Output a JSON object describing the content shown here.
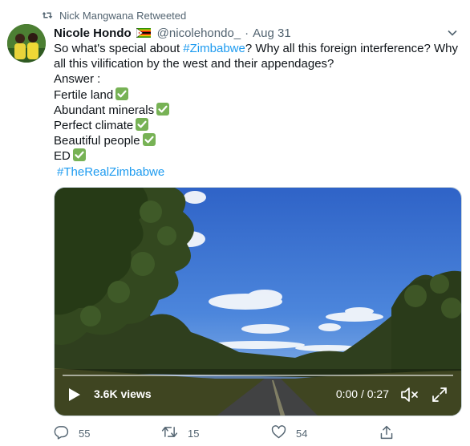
{
  "retweet": {
    "label": "Nick Mangwana Retweeted"
  },
  "tweet": {
    "author_name": "Nicole Hondo",
    "author_handle": "@nicolehondo_",
    "separator": "·",
    "date": "Aug 31",
    "text": {
      "p1_before": "So what's special about ",
      "p1_hashtag": "#Zimbabwe",
      "p1_after": "? Why all this foreign interference? Why all this vilification by the west and their appendages?",
      "answer": "Answer :",
      "items": [
        "Fertile land",
        "Abundant minerals",
        "Perfect climate",
        "Beautiful people",
        "ED"
      ],
      "hashtag": "#TheRealZimbabwe"
    }
  },
  "video": {
    "views": "3.6K views",
    "time": "0:00 / 0:27"
  },
  "actions": {
    "reply_count": "55",
    "retweet_count": "15",
    "like_count": "54"
  },
  "colors": {
    "accent": "#1d9bf0",
    "muted": "#536471",
    "check_green": "#77b255"
  },
  "icons": {
    "retweet": "retweet-icon",
    "flag": "zimbabwe-flag-icon",
    "caret": "chevron-down-icon",
    "check": "check-mark-button-icon",
    "play": "play-icon",
    "mute": "speaker-muted-icon",
    "fullscreen": "fullscreen-icon",
    "reply": "reply-icon",
    "share": "share-icon",
    "like": "heart-icon"
  }
}
